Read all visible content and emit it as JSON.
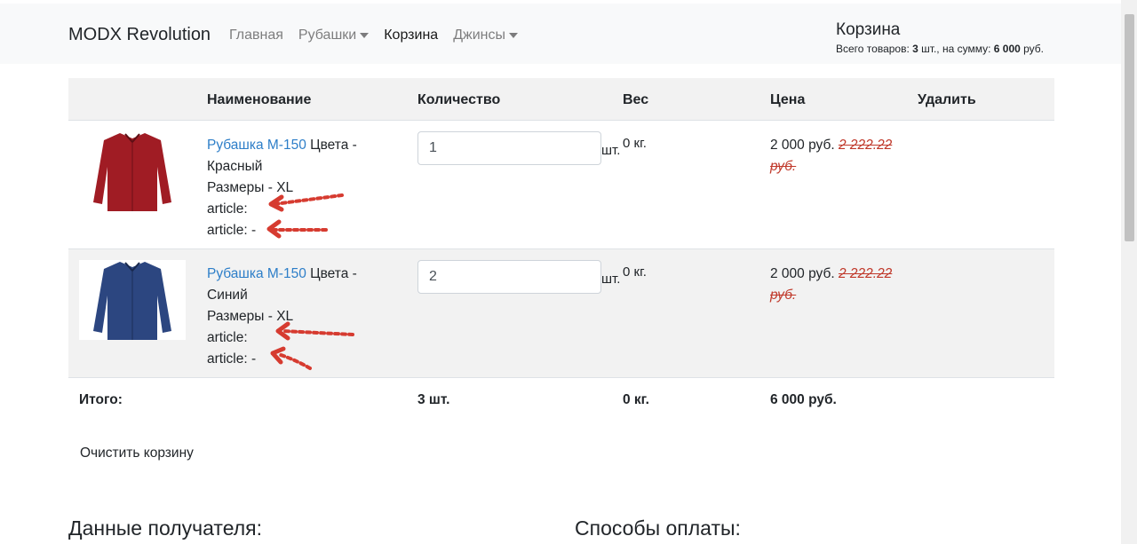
{
  "navbar": {
    "brand": "MODX Revolution",
    "links": [
      "Главная",
      "Рубашки",
      "Корзина",
      "Джинсы"
    ]
  },
  "mini_cart": {
    "title": "Корзина",
    "info_prefix": "Всего товаров: ",
    "count": "3",
    "info_mid": " шт., на сумму: ",
    "sum": "6 000",
    "info_suffix": " руб."
  },
  "table": {
    "headers": [
      "Наименование",
      "Количество",
      "Вес",
      "Цена",
      "Удалить"
    ],
    "rows": [
      {
        "name": "Рубашка М-150",
        "color_label": "Цвета - Красный",
        "size_label": "Размеры - XL",
        "article1": "article:",
        "article2": "article: -",
        "qty": "1",
        "unit": "шт.",
        "weight": "0 кг.",
        "price": "2 000 руб.",
        "old_price": "2 222.22 руб.",
        "shirt_color": "#a01c24"
      },
      {
        "name": "Рубашка М-150",
        "color_label": "Цвета - Синий",
        "size_label": "Размеры - XL",
        "article1": "article:",
        "article2": "article: -",
        "qty": "2",
        "unit": "шт.",
        "weight": "0 кг.",
        "price": "2 000 руб.",
        "old_price": "2 222.22 руб.",
        "shirt_color": "#2c4680"
      }
    ],
    "total": {
      "label": "Итого:",
      "qty": "3 шт.",
      "weight": "0 кг.",
      "price": "6 000 руб."
    }
  },
  "clear_label": "Очистить корзину",
  "sections": {
    "recipient": "Данные получателя:",
    "payment": "Способы оплаты:"
  },
  "colors": {
    "link": "#2d7ec8",
    "annotation_red": "#d63b30",
    "row_alt": "#f2f2f2"
  }
}
